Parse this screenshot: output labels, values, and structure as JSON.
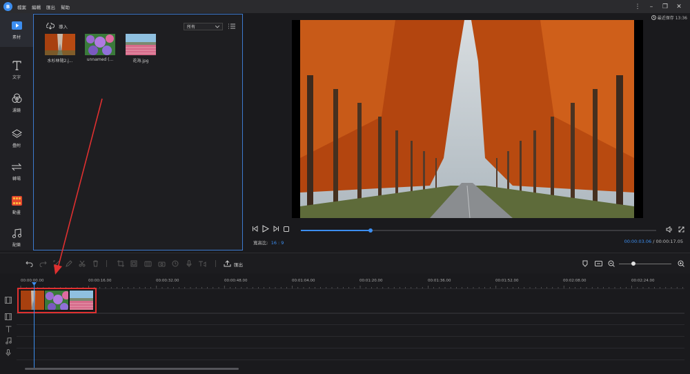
{
  "app": {
    "logo": "B",
    "menu": [
      "檔案",
      "編輯",
      "匯出",
      "幫助"
    ],
    "save_status": "最近保存 13:36"
  },
  "sidebar": {
    "items": [
      {
        "label": "素材",
        "icon": "play-icon",
        "active": true
      },
      {
        "label": "文字",
        "icon": "text-icon"
      },
      {
        "label": "濾鏡",
        "icon": "filter-icon"
      },
      {
        "label": "疊附",
        "icon": "overlay-icon"
      },
      {
        "label": "轉場",
        "icon": "transition-icon"
      },
      {
        "label": "動畫",
        "icon": "animation-icon"
      },
      {
        "label": "配樂",
        "icon": "music-icon"
      }
    ]
  },
  "media": {
    "import_label": "導入",
    "filter_value": "所有",
    "files": [
      {
        "name": "水杉林隨2.j...",
        "image": "autumn-trees-road"
      },
      {
        "name": "unnamed (...",
        "image": "purple-flowers"
      },
      {
        "name": "花海.jpg",
        "image": "flower-field"
      }
    ]
  },
  "preview": {
    "aspect_label": "寬高比:",
    "aspect_value": "16 : 9",
    "current_time": "00:00:03.06",
    "time_separator": "/",
    "total_time": "00:00:17.05",
    "progress": 0.196
  },
  "toolbar": {
    "export_label": "匯出",
    "zoom": 0.27
  },
  "timeline": {
    "ruler": [
      "00:00:00.00",
      "00:00:16.00",
      "00:00:32.00",
      "00:00:48.00",
      "00:01:04.00",
      "00:01:20.00",
      "00:01:36.00",
      "00:01:52.00",
      "00:02:08.00",
      "00:02:24.00"
    ],
    "tracks": [
      "video-track-icon",
      "pip-track-icon",
      "text-track-icon",
      "music-track-icon",
      "voice-track-icon"
    ]
  },
  "colors": {
    "accent": "#3c8ef0",
    "highlight": "#e03030"
  }
}
